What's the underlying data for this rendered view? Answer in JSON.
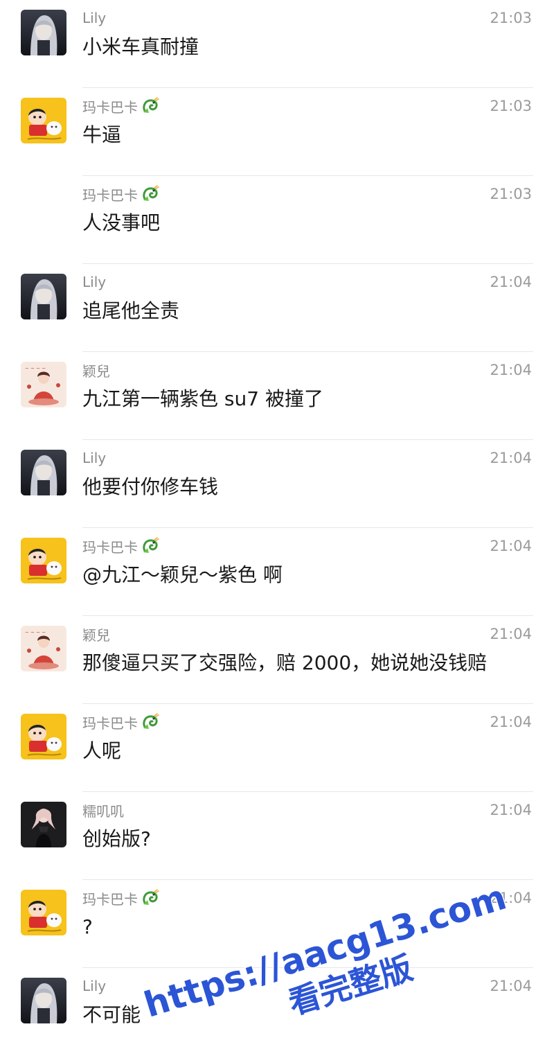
{
  "chat": {
    "messages": [
      {
        "sender": "Lily",
        "time": "21:03",
        "text": "小米车真耐撞",
        "avatar": "lily",
        "badge": ""
      },
      {
        "sender": "玛卡巴卡",
        "time": "21:03",
        "text": "牛逼",
        "avatar": "shin",
        "badge": "dragon-icon"
      },
      {
        "sender": "玛卡巴卡",
        "time": "21:03",
        "text": "人没事吧",
        "avatar": "",
        "badge": "dragon-icon"
      },
      {
        "sender": "Lily",
        "time": "21:04",
        "text": "追尾他全责",
        "avatar": "lily",
        "badge": ""
      },
      {
        "sender": "颖兒",
        "time": "21:04",
        "text": "九江第一辆紫色 su7 被撞了",
        "avatar": "ying",
        "badge": ""
      },
      {
        "sender": "Lily",
        "time": "21:04",
        "text": "他要付你修车钱",
        "avatar": "lily",
        "badge": ""
      },
      {
        "sender": "玛卡巴卡",
        "time": "21:04",
        "text": "@九江～颖兒～紫色 啊",
        "avatar": "shin",
        "badge": "dragon-icon"
      },
      {
        "sender": "颖兒",
        "time": "21:04",
        "text": "那傻逼只买了交强险，赔 2000，她说她没钱赔",
        "avatar": "ying",
        "badge": ""
      },
      {
        "sender": "玛卡巴卡",
        "time": "21:04",
        "text": "人呢",
        "avatar": "shin",
        "badge": "dragon-icon"
      },
      {
        "sender": "糯叽叽",
        "time": "21:04",
        "text": "创始版?",
        "avatar": "nuo",
        "badge": ""
      },
      {
        "sender": "玛卡巴卡",
        "time": "21:04",
        "text": "?",
        "avatar": "shin",
        "badge": "dragon-icon"
      },
      {
        "sender": "Lily",
        "time": "21:04",
        "text": "不可能",
        "avatar": "lily",
        "badge": ""
      }
    ]
  },
  "watermark": {
    "line1": "https://aacg13.com",
    "line2": "看完整版",
    "color": "#2c55d6"
  },
  "colors": {
    "name": "#8a8a8a",
    "time": "#9a9a9a",
    "text": "#191919",
    "divider": "#e6e6e6"
  }
}
